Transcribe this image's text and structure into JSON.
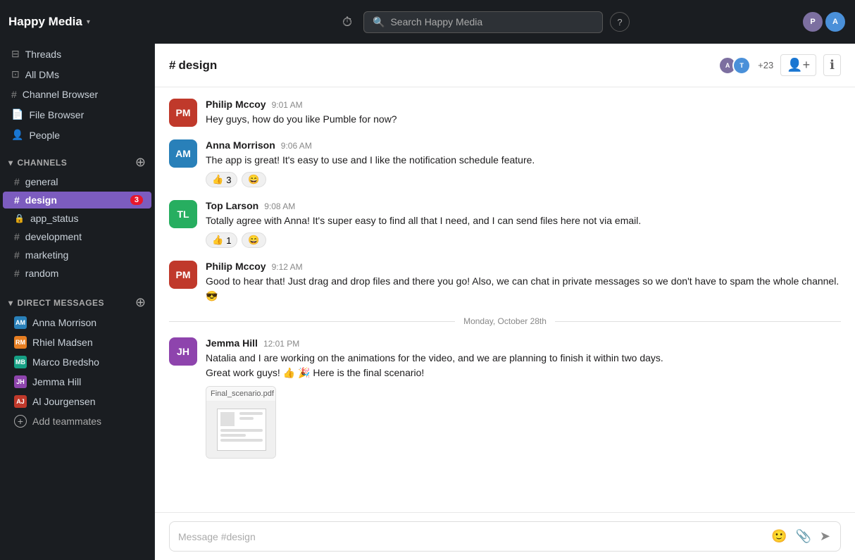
{
  "app": {
    "workspace_name": "Happy Media",
    "topbar": {
      "search_placeholder": "Search Happy Media",
      "help_label": "?",
      "history_icon": "⏱"
    }
  },
  "sidebar": {
    "nav_items": [
      {
        "id": "threads",
        "label": "Threads",
        "icon": "⊟"
      },
      {
        "id": "all-dms",
        "label": "All DMs",
        "icon": "⊡"
      },
      {
        "id": "channel-browser",
        "label": "Channel Browser",
        "icon": "#"
      },
      {
        "id": "file-browser",
        "label": "File Browser",
        "icon": "⬜"
      },
      {
        "id": "people",
        "label": "People",
        "icon": "👤"
      }
    ],
    "channels_section": {
      "title": "CHANNELS",
      "items": [
        {
          "id": "general",
          "name": "general",
          "type": "public",
          "active": false,
          "badge": null
        },
        {
          "id": "design",
          "name": "design",
          "type": "public",
          "active": true,
          "badge": "3"
        },
        {
          "id": "app_status",
          "name": "app_status",
          "type": "private",
          "active": false,
          "badge": null
        },
        {
          "id": "development",
          "name": "development",
          "type": "public",
          "active": false,
          "badge": null
        },
        {
          "id": "marketing",
          "name": "marketing",
          "type": "public",
          "active": false,
          "badge": null
        },
        {
          "id": "random",
          "name": "random",
          "type": "public",
          "active": false,
          "badge": null
        }
      ]
    },
    "dm_section": {
      "title": "DIRECT MESSAGES",
      "items": [
        {
          "id": "anna",
          "name": "Anna Morrison",
          "status": "online",
          "color": "#2980b9",
          "initials": "AM"
        },
        {
          "id": "rhiel",
          "name": "Rhiel Madsen",
          "status": "online",
          "color": "#e67e22",
          "initials": "RM"
        },
        {
          "id": "marco",
          "name": "Marco Bredsho",
          "status": "offline",
          "color": "#16a085",
          "initials": "MB"
        },
        {
          "id": "jemma",
          "name": "Jemma Hill",
          "status": "online",
          "color": "#8e44ad",
          "initials": "JH"
        },
        {
          "id": "al",
          "name": "Al Jourgensen",
          "status": "online",
          "color": "#c0392b",
          "initials": "AJ"
        }
      ],
      "add_label": "Add teammates"
    }
  },
  "channel": {
    "name": "design",
    "member_count": "+23",
    "messages": [
      {
        "id": "msg1",
        "author": "Philip Mccoy",
        "time": "9:01 AM",
        "text": "Hey guys, how do you like Pumble for now?",
        "reactions": [],
        "avatar_color": "#c0392b",
        "initials": "PM"
      },
      {
        "id": "msg2",
        "author": "Anna Morrison",
        "time": "9:06 AM",
        "text": "The app is great! It's easy to use and I like the notification schedule feature.",
        "reactions": [
          {
            "emoji": "👍",
            "count": "3"
          },
          {
            "emoji": "😄",
            "count": ""
          }
        ],
        "avatar_color": "#2980b9",
        "initials": "AM"
      },
      {
        "id": "msg3",
        "author": "Top Larson",
        "time": "9:08 AM",
        "text": "Totally agree with Anna! It's super easy to find all that I need, and I can send files here not via email.",
        "reactions": [
          {
            "emoji": "👍",
            "count": "1"
          },
          {
            "emoji": "😄",
            "count": ""
          }
        ],
        "avatar_color": "#27ae60",
        "initials": "TL"
      },
      {
        "id": "msg4",
        "author": "Philip Mccoy",
        "time": "9:12 AM",
        "text": "Good to hear that! Just drag and drop files and there you go! Also, we can chat in private messages so we don't have to spam the whole channel. 😎",
        "reactions": [],
        "avatar_color": "#c0392b",
        "initials": "PM"
      }
    ],
    "date_divider": "Monday, October 28th",
    "later_messages": [
      {
        "id": "msg5",
        "author": "Jemma Hill",
        "time": "12:01 PM",
        "text_line1": "Natalia and I are working on the animations for the video, and we are planning to finish it within two days.",
        "text_line2": "Great work guys! 👍 🎉  Here is the final scenario!",
        "has_file": true,
        "file_name": "Final_scenario.pdf",
        "avatar_color": "#8e44ad",
        "initials": "JH"
      }
    ],
    "input_placeholder": "Message #design"
  }
}
